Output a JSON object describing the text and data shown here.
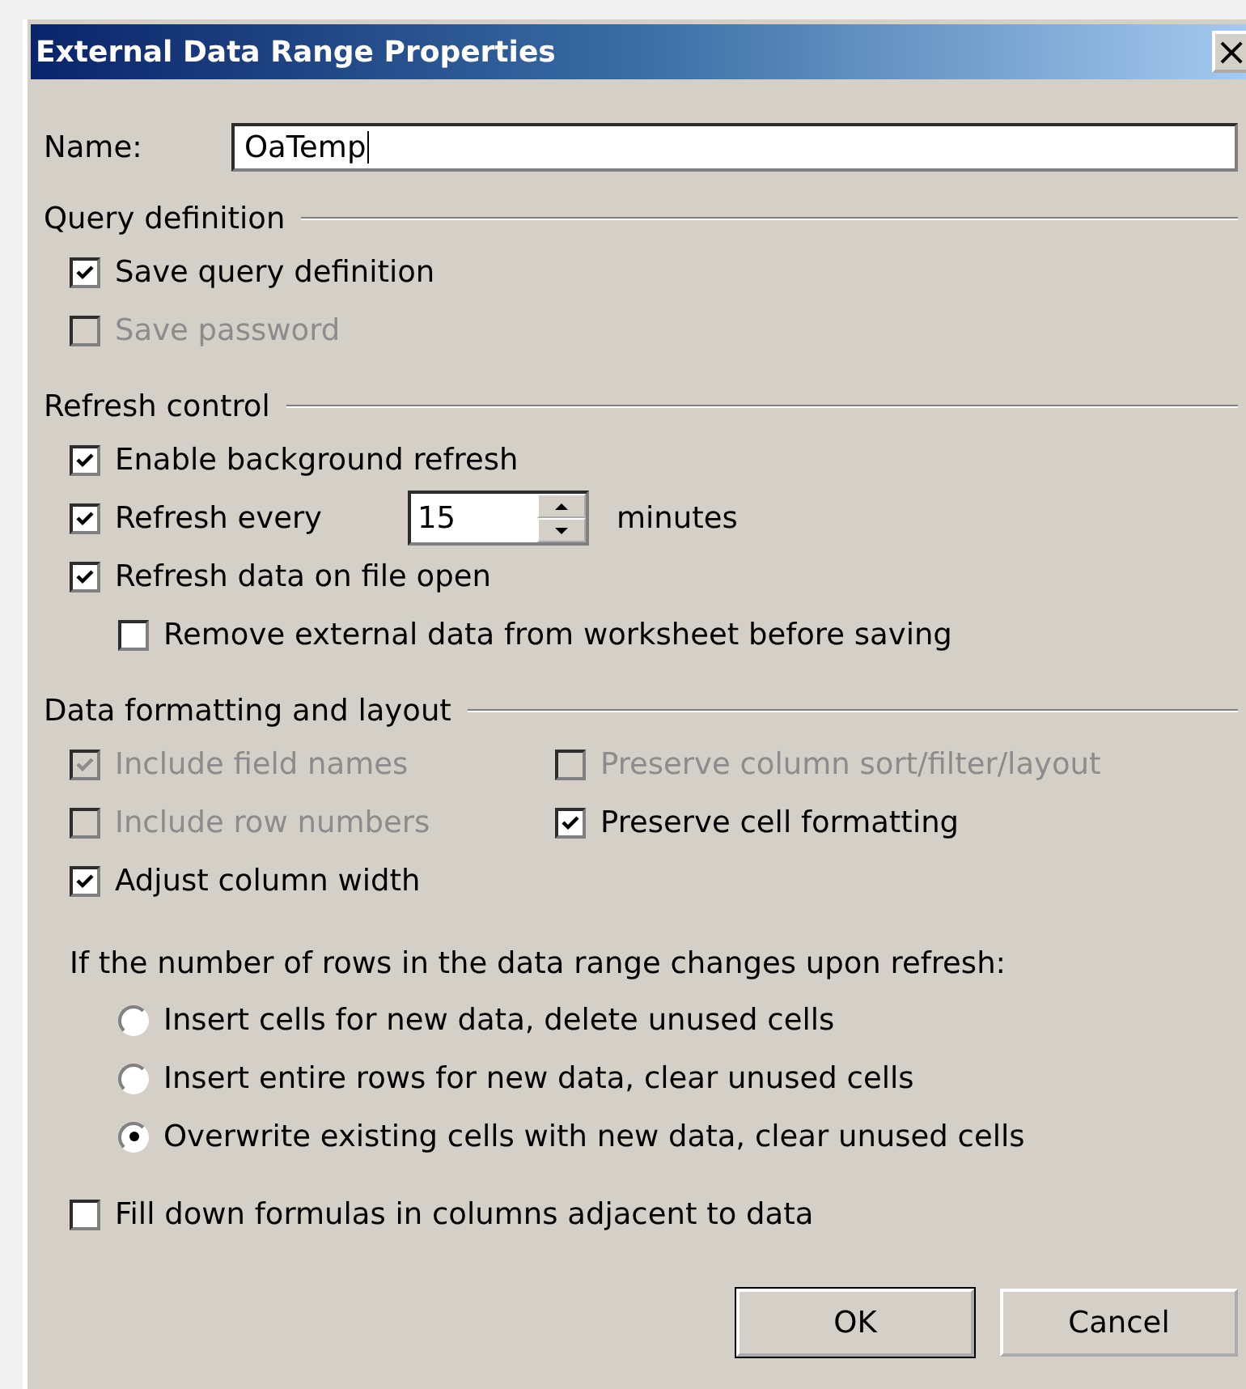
{
  "window": {
    "title": "External Data Range Properties",
    "close": "×"
  },
  "name_field": {
    "label": "Name:",
    "value": "OaTemp"
  },
  "sections": [
    {
      "title": "Query definition",
      "items": [
        {
          "kind": "checkbox",
          "label": "Save query definition",
          "checked": true,
          "disabled": false
        },
        {
          "kind": "checkbox",
          "label": "Save password",
          "checked": false,
          "disabled": true
        }
      ]
    },
    {
      "title": "Refresh control",
      "items": [
        {
          "kind": "checkbox",
          "label": "Enable background refresh",
          "checked": true,
          "disabled": false
        },
        {
          "kind": "spin",
          "label": "Refresh every",
          "checked": true,
          "disabled": false,
          "value": "15",
          "unit": "minutes"
        },
        {
          "kind": "checkbox",
          "label": "Refresh data on file open",
          "checked": true,
          "disabled": false,
          "children": [
            {
              "kind": "checkbox",
              "label": "Remove external data from worksheet before saving",
              "checked": false,
              "disabled": false
            }
          ]
        }
      ]
    },
    {
      "title": "Data formatting and layout",
      "grid": true,
      "items": [
        {
          "kind": "checkbox",
          "label": "Include field names",
          "checked": true,
          "disabled": true
        },
        {
          "kind": "checkbox",
          "label": "Preserve column sort/filter/layout",
          "checked": false,
          "disabled": true
        },
        {
          "kind": "checkbox",
          "label": "Include row numbers",
          "checked": false,
          "disabled": true
        },
        {
          "kind": "checkbox",
          "label": "Preserve cell formatting",
          "checked": true,
          "disabled": false
        },
        {
          "kind": "checkbox",
          "label": "Adjust column width",
          "checked": true,
          "disabled": false
        }
      ]
    }
  ],
  "refresh_rows": {
    "prompt": "If the number of rows in the data range changes upon refresh:",
    "options": [
      {
        "label": "Insert cells for new data, delete unused cells",
        "selected": false
      },
      {
        "label": "Insert entire rows for new data, clear unused cells",
        "selected": false
      },
      {
        "label": "Overwrite existing cells with new data, clear unused cells",
        "selected": true
      }
    ]
  },
  "fill_down": {
    "label": "Fill down formulas in columns adjacent to data",
    "checked": false
  },
  "buttons": [
    "OK",
    "Cancel"
  ]
}
